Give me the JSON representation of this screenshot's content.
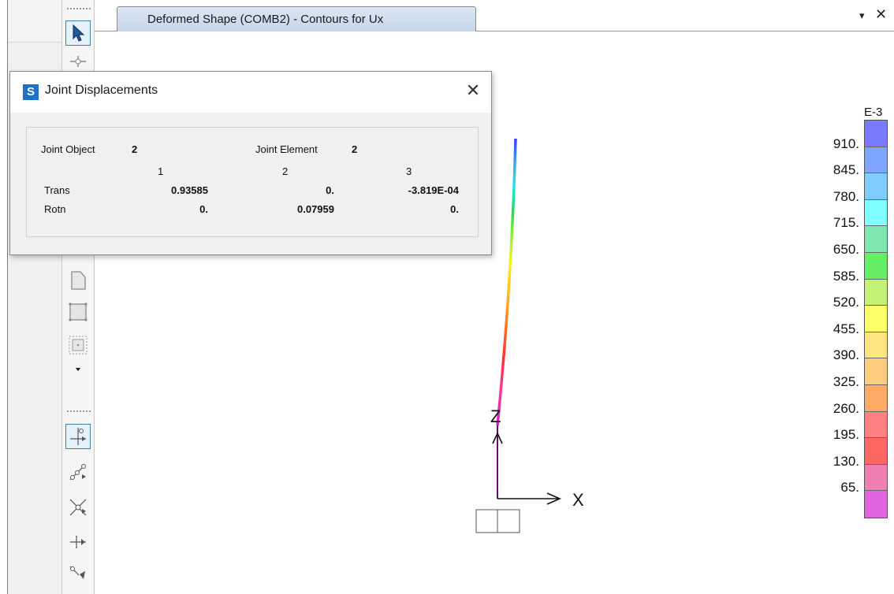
{
  "tab": {
    "title": "Deformed Shape (COMB2) - Contours for Ux",
    "menu_glyph": "▾",
    "close_glyph": "✕"
  },
  "dialog": {
    "logo": "S",
    "title": "Joint Displacements",
    "close_glyph": "✕",
    "joint_object_label": "Joint  Object",
    "joint_object_value": "2",
    "joint_element_label": "Joint Element",
    "joint_element_value": "2",
    "columns": [
      "1",
      "2",
      "3"
    ],
    "rows": [
      {
        "label": "Trans",
        "values": [
          "0.93585",
          "0.",
          "-3.819E-04"
        ]
      },
      {
        "label": "Rotn",
        "values": [
          "0.",
          "0.07959",
          "0."
        ]
      }
    ]
  },
  "legend": {
    "unit": "E-3",
    "labels": [
      "910.",
      "845.",
      "780.",
      "715.",
      "650.",
      "585.",
      "520.",
      "455.",
      "390.",
      "325.",
      "260.",
      "195.",
      "130.",
      "65."
    ],
    "colors": [
      "#7a7aff",
      "#7fa6ff",
      "#80ccff",
      "#7fffff",
      "#7fe8b0",
      "#66ee66",
      "#c2f277",
      "#ffff66",
      "#ffe57f",
      "#ffcc80",
      "#ffaa66",
      "#ff8080",
      "#ff6666",
      "#f07fb2",
      "#e066e0"
    ]
  },
  "axes": {
    "z_label": "Z",
    "x_label": "X"
  },
  "toolbar": {
    "icons": [
      "pointer-icon",
      "joint-icon",
      "frame-icon",
      "area-icon",
      "solid-icon",
      "dropdown-icon",
      "snap-joint-icon",
      "snap-line-icon",
      "snap-intersection-icon",
      "snap-perpendicular-icon",
      "snap-end-icon"
    ]
  }
}
